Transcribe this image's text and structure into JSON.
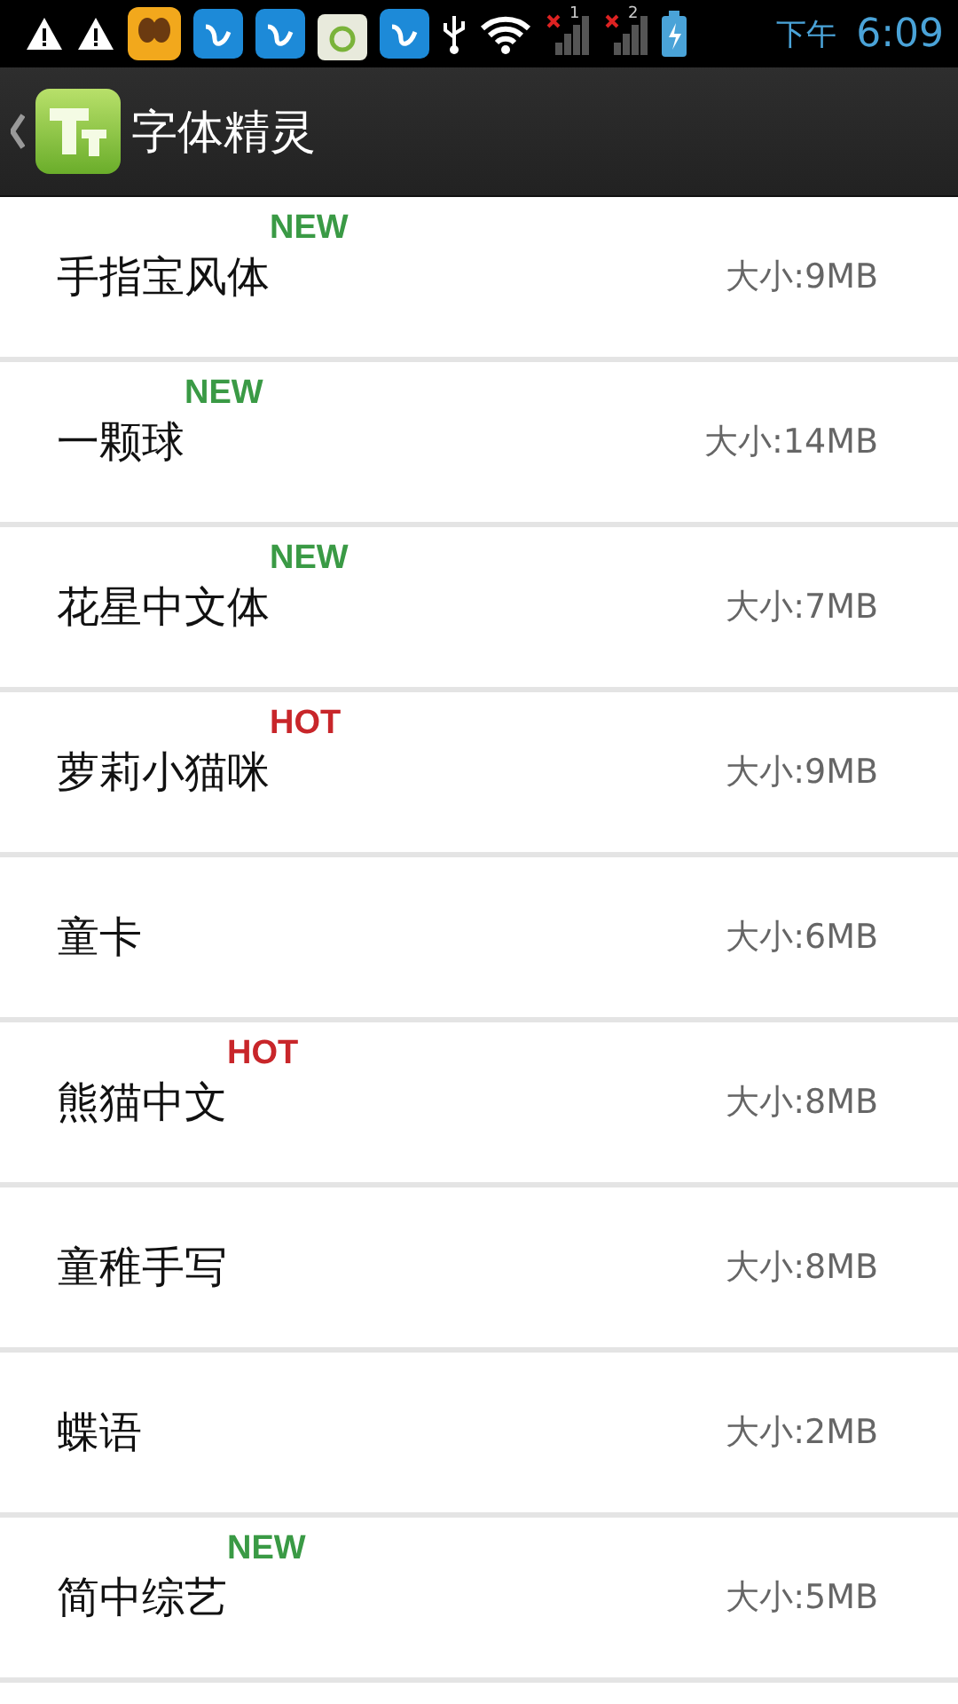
{
  "status_bar": {
    "sims": [
      "1",
      "2"
    ],
    "time_period": "下午",
    "time": "6:09"
  },
  "header": {
    "title": "字体精灵"
  },
  "fonts": [
    {
      "name": "手指宝风体",
      "badge": {
        "kind": "new",
        "text": "NEW"
      },
      "size": "大小:9MB"
    },
    {
      "name": "一颗球",
      "badge": {
        "kind": "new",
        "text": "NEW"
      },
      "size": "大小:14MB"
    },
    {
      "name": "花星中文体",
      "badge": {
        "kind": "new",
        "text": "NEW"
      },
      "size": "大小:7MB"
    },
    {
      "name": "萝莉小猫咪",
      "badge": {
        "kind": "hot",
        "text": "HOT"
      },
      "size": "大小:9MB"
    },
    {
      "name": "童卡",
      "size": "大小:6MB"
    },
    {
      "name": "熊猫中文",
      "badge": {
        "kind": "hot",
        "text": "HOT"
      },
      "size": "大小:8MB"
    },
    {
      "name": "童稚手写",
      "size": "大小:8MB"
    },
    {
      "name": "蝶语",
      "size": "大小:2MB"
    },
    {
      "name": "简中综艺",
      "badge": {
        "kind": "new",
        "text": "NEW"
      },
      "size": "大小:5MB"
    }
  ]
}
